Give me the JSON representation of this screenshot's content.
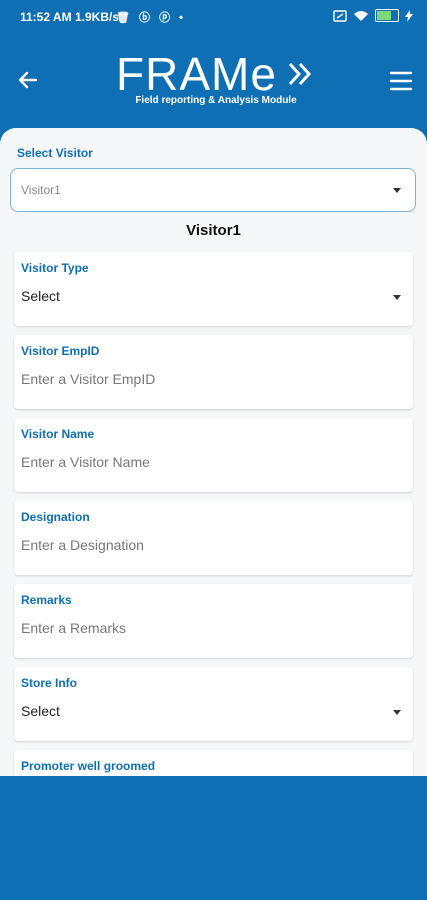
{
  "status": {
    "time": "11:52 AM",
    "speed": "1.9KB/s",
    "left_icons": "🗑 ⓑ ⓟ •",
    "battery_percent": 80
  },
  "app": {
    "logo": "FRAMe",
    "tagline": "Field reporting & Analysis Module"
  },
  "select_visitor": {
    "label": "Select Visitor",
    "value": "Visitor1"
  },
  "visitor_heading": "Visitor1",
  "fields": [
    {
      "label": "Visitor Type",
      "value": "Select"
    },
    {
      "label": "Visitor EmpID",
      "placeholder": "Enter a Visitor EmpID"
    },
    {
      "label": "Visitor Name",
      "placeholder": "Enter a Visitor Name"
    },
    {
      "label": "Designation",
      "placeholder": "Enter a Designation"
    },
    {
      "label": "Remarks",
      "placeholder": "Enter a Remarks"
    },
    {
      "label": "Store Info",
      "value": "Select"
    },
    {
      "label": "Promoter well groomed"
    }
  ],
  "colors": {
    "primary": "#0e6fb5",
    "panel": "#f6f7f9"
  }
}
